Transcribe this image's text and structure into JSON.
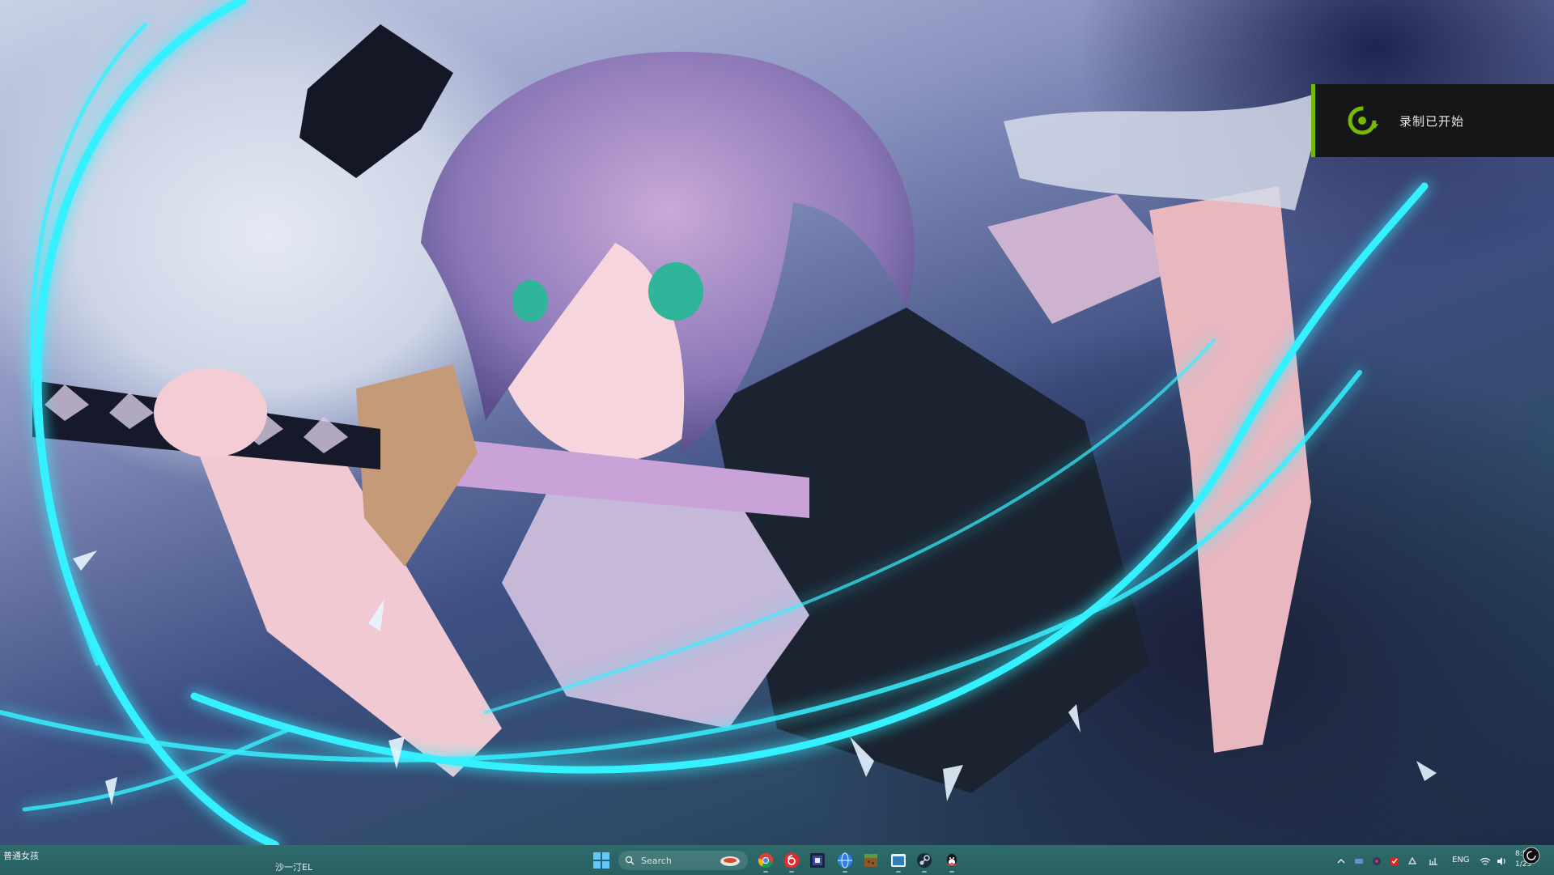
{
  "notification": {
    "text": "录制已开始",
    "accent_color": "#76b900",
    "icon": "record-circle-icon"
  },
  "desktop": {
    "wallpaper": "anime-wallpaper",
    "corner_label": "普通女孩"
  },
  "taskbar": {
    "left_label": "沙一汀EL",
    "search_placeholder": "Search",
    "apps": [
      {
        "name": "chrome-icon"
      },
      {
        "name": "netease-music-icon"
      },
      {
        "name": "dark-app-icon"
      },
      {
        "name": "browser-globe-icon"
      },
      {
        "name": "minecraft-icon"
      },
      {
        "name": "window-app-icon"
      },
      {
        "name": "steam-icon"
      },
      {
        "name": "qq-icon"
      }
    ],
    "tray": {
      "language": "ENG",
      "time": "8:5",
      "date": "1/25"
    }
  }
}
